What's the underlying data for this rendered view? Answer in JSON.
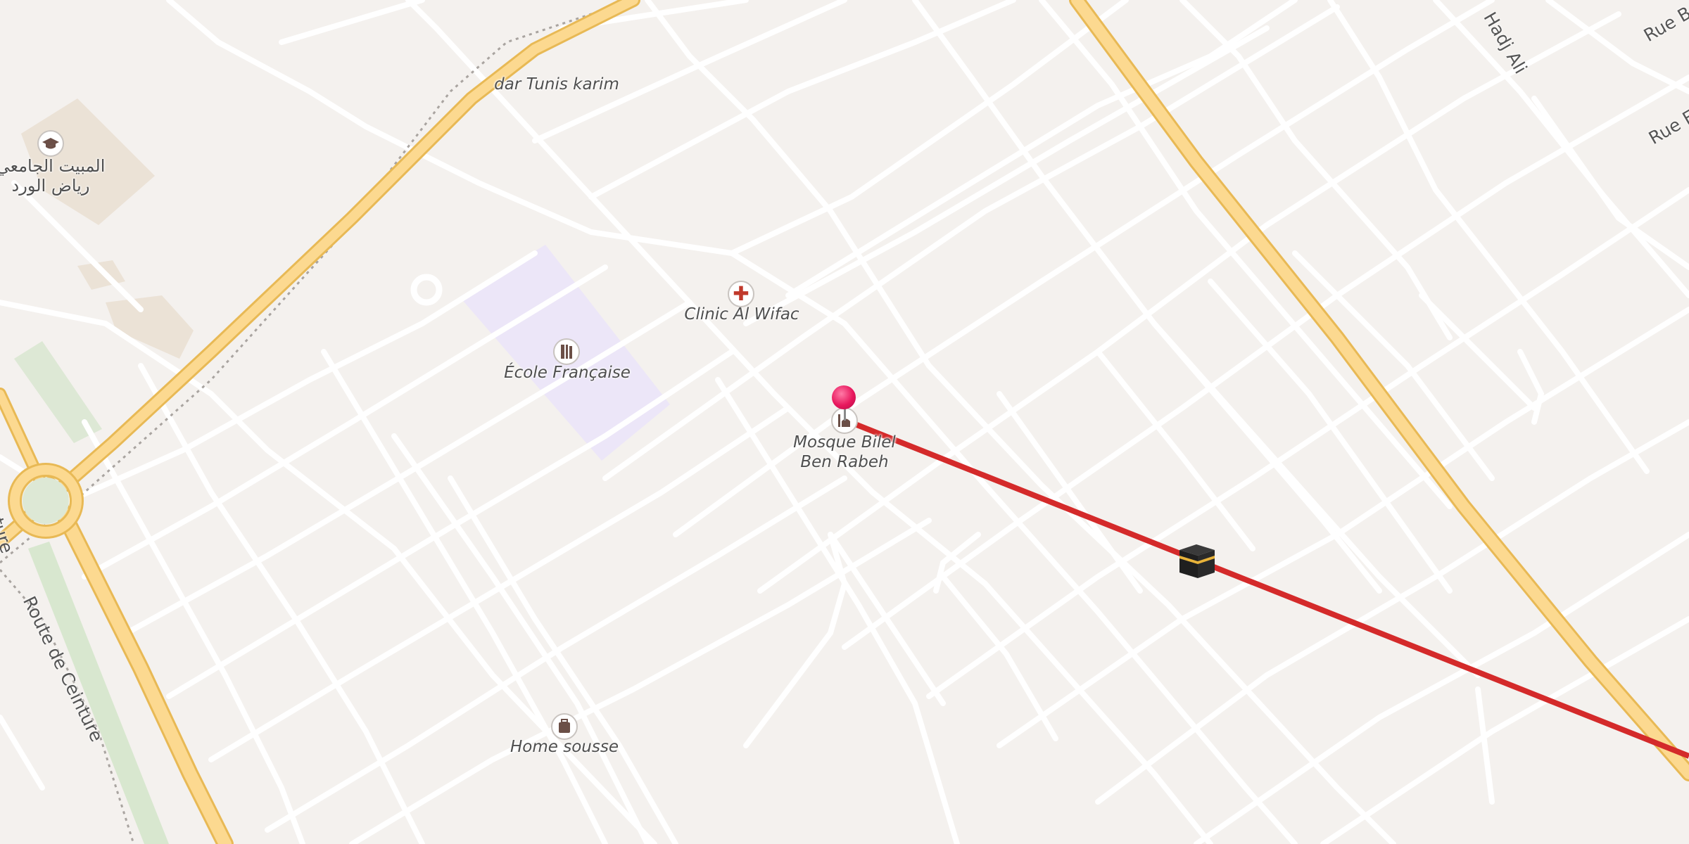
{
  "map": {
    "places": {
      "dar_tunis": "dar Tunis karim",
      "clinic": "Clinic Al Wifac",
      "ecole": "École Française",
      "mosque_line1": "Mosque Bilel",
      "mosque_line2": "Ben Rabeh",
      "home": "Home sousse",
      "university_line1": "المبيت الجامعي",
      "university_line2": "رياض الورد"
    },
    "roads": {
      "ceinture_main": "Route de Ceinture",
      "ceinture_left": "Ceinture",
      "rue_top": "Rue B",
      "rue_right": "Rue Es",
      "hadj_ali": "Hadj Ali"
    },
    "icons": {
      "clinic": "red-cross-icon",
      "school": "book-icon",
      "university": "graduation-cap-icon",
      "mosque": "mosque-icon",
      "home": "luggage-icon",
      "kaaba": "kaaba-icon",
      "pin": "location-pin-icon"
    },
    "colors": {
      "qibla_line": "#d42a2a",
      "pin": "#e8175d",
      "main_road_fill": "#fcd990",
      "main_road_casing": "#e8b955",
      "school_area": "#ece6f8"
    }
  }
}
